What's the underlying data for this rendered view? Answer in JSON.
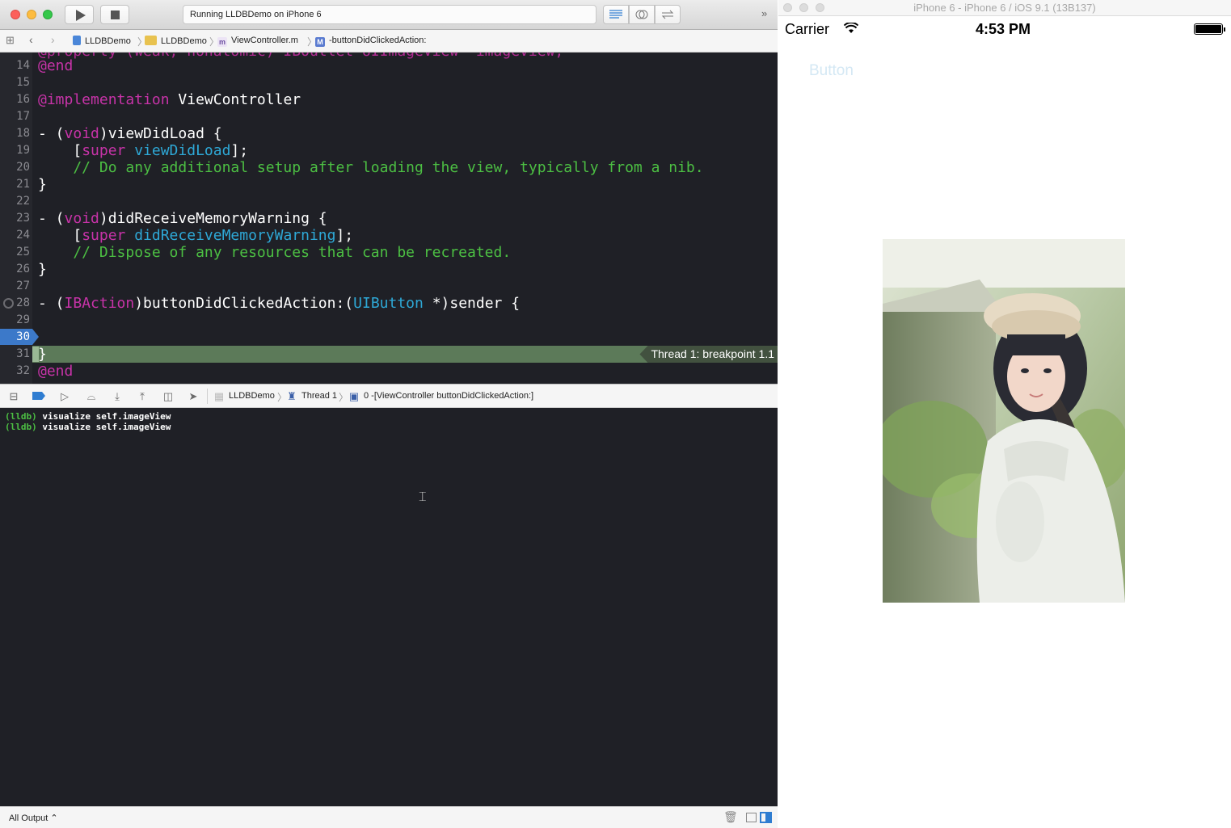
{
  "xcode": {
    "toolbar": {
      "activity_text": "Running LLDBDemo on iPhone 6"
    },
    "jumpbar": {
      "project": "LLDBDemo",
      "group": "LLDBDemo",
      "file_type": "m",
      "file": "ViewController.m",
      "method_type": "M",
      "method": "-buttonDidClickedAction:"
    },
    "editor": {
      "partial_top": "@property (weak, nonatomic) IBOutlet UIImageView *imageView;",
      "lines": [
        {
          "n": "14",
          "text": "@end"
        },
        {
          "n": "15",
          "text": ""
        },
        {
          "n": "16",
          "kw": "@implementation",
          "rest": " ViewController"
        },
        {
          "n": "17",
          "text": ""
        },
        {
          "n": "18",
          "a": "- (",
          "kw": "void",
          "rest": ")viewDidLoad {"
        },
        {
          "n": "19",
          "a": "    [",
          "kw": "super",
          "fn": " viewDidLoad",
          "rest": "];"
        },
        {
          "n": "20",
          "comment": "    // Do any additional setup after loading the view, typically from a nib."
        },
        {
          "n": "21",
          "text": "}"
        },
        {
          "n": "22",
          "text": ""
        },
        {
          "n": "23",
          "a": "- (",
          "kw": "void",
          "rest": ")didReceiveMemoryWarning {"
        },
        {
          "n": "24",
          "a": "    [",
          "kw": "super",
          "fn": " didReceiveMemoryWarning",
          "rest": "];"
        },
        {
          "n": "25",
          "comment": "    // Dispose of any resources that can be recreated."
        },
        {
          "n": "26",
          "text": "}"
        },
        {
          "n": "27",
          "text": ""
        },
        {
          "n": "28",
          "a": "- (",
          "kw": "IBAction",
          "b": ")buttonDidClickedAction:(",
          "fn": "UIButton",
          "rest": " *)sender {"
        },
        {
          "n": "29",
          "text": ""
        },
        {
          "n": "30",
          "text": ""
        },
        {
          "n": "31",
          "text": "}"
        },
        {
          "n": "32",
          "text": "@end"
        }
      ],
      "breakpoint_line": "30",
      "current_line": "31",
      "breakpoint_label": "Thread 1: breakpoint 1.1"
    },
    "debugbar": {
      "project": "LLDBDemo",
      "thread": "Thread 1",
      "frame": "0 -[ViewController buttonDidClickedAction:]"
    },
    "console": {
      "lines": [
        {
          "prompt": "(lldb)",
          "cmd": " visualize self.imageView"
        },
        {
          "prompt": "(lldb)",
          "cmd": " visualize self.imageView"
        }
      ]
    },
    "statusbar": {
      "output_filter": "All Output ⌃"
    }
  },
  "simulator": {
    "title": "iPhone 6 - iPhone 6 / iOS 9.1 (13B137)",
    "status": {
      "carrier": "Carrier",
      "time": "4:53 PM"
    },
    "button_label": "Button"
  },
  "colors": {
    "editor_bg": "#1f2026",
    "keyword": "#c733a8",
    "function": "#2ea8d6",
    "comment": "#4cbf43",
    "breakpoint": "#3c79c9",
    "current_line": "#5c7a59"
  },
  "icons": [
    "play-icon",
    "stop-icon",
    "grid-icon",
    "back-icon",
    "forward-icon",
    "file-icon",
    "folder-icon",
    "wifi-icon",
    "battery-icon",
    "trash-icon"
  ]
}
